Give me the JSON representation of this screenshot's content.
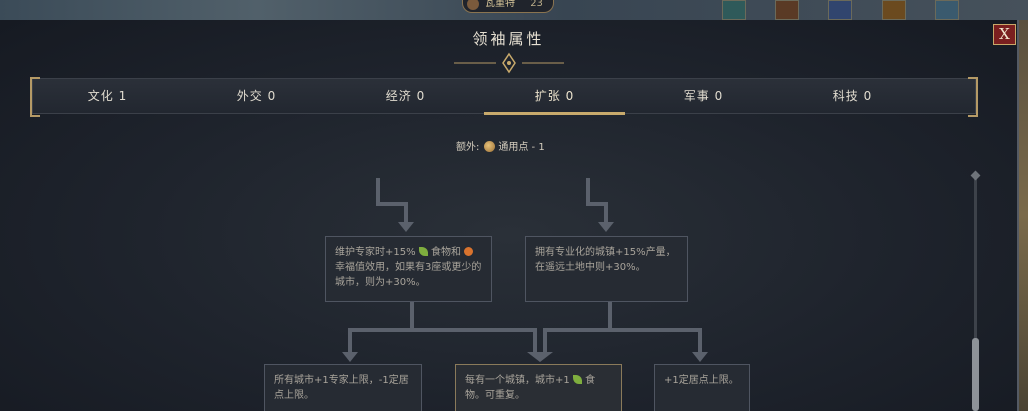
{
  "hud": {
    "leader_name": "瓦重特",
    "leader_level": "23"
  },
  "panel": {
    "title": "领袖属性",
    "close_label": "X"
  },
  "tabs": [
    {
      "label": "文化 1",
      "active": false
    },
    {
      "label": "外交 0",
      "active": false
    },
    {
      "label": "经济 0",
      "active": false
    },
    {
      "label": "扩张 0",
      "active": true
    },
    {
      "label": "军事 0",
      "active": false
    },
    {
      "label": "科技 0",
      "active": false
    }
  ],
  "extra": {
    "label": "额外:",
    "icon": "general-point-icon",
    "value": "通用点 - 1"
  },
  "nodes": {
    "specialist": {
      "part1": "维护专家时+15%",
      "part2": "食物和",
      "part3": "幸福值效用，如果有3座或更少的城市，则为+30%。"
    },
    "specialized_town": {
      "text": "拥有专业化的城镇+15%产量，在遥远土地中则+30%。"
    },
    "city_specialist": {
      "text": "所有城市+1专家上限，-1定居点上限。"
    },
    "per_town": {
      "part1": "每有一个城镇，城市+1",
      "part2": "食物。可重复。"
    },
    "settlement_cap": {
      "text": "+1定居点上限。"
    }
  },
  "colors": {
    "accent": "#c8aa6c",
    "close": "#7a1f1f",
    "food": "#7fae3e",
    "happiness": "#d9732e"
  }
}
